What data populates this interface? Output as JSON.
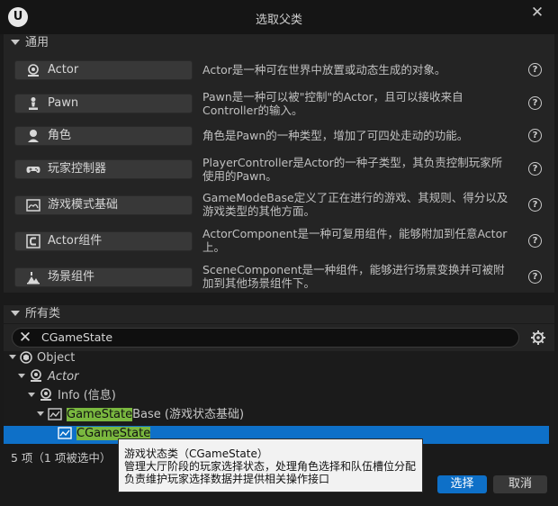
{
  "window": {
    "title": "选取父类",
    "close_glyph": "✕",
    "logo_glyph": "U"
  },
  "common": {
    "header": "通用",
    "items": [
      {
        "label": "Actor",
        "icon": "actor-icon",
        "desc": "Actor是一种可在世界中放置或动态生成的对象。"
      },
      {
        "label": "Pawn",
        "icon": "pawn-icon",
        "desc": "Pawn是一种可以被\"控制\"的Actor，且可以接收来自Controller的输入。"
      },
      {
        "label": "角色",
        "icon": "character-icon",
        "desc": "角色是Pawn的一种类型，增加了可四处走动的功能。"
      },
      {
        "label": "玩家控制器",
        "icon": "gamepad-icon",
        "desc": "PlayerController是Actor的一种子类型，其负责控制玩家所使用的Pawn。"
      },
      {
        "label": "游戏模式基础",
        "icon": "gamemode-icon",
        "desc": "GameModeBase定义了正在进行的游戏、其规则、得分以及游戏类型的其他方面。"
      },
      {
        "label": "Actor组件",
        "icon": "component-icon",
        "desc": "ActorComponent是一种可复用组件，能够附加到任意Actor上。"
      },
      {
        "label": "场景组件",
        "icon": "scene-component-icon",
        "desc": "SceneComponent是一种组件，能够进行场景变换并可被附加到其他场景组件下。"
      }
    ],
    "help_glyph": "?"
  },
  "all_classes": {
    "header": "所有类",
    "search_value": "CGameState",
    "clear_glyph": "✕"
  },
  "tree": {
    "nodes": [
      {
        "label": "Object"
      },
      {
        "label": "Actor"
      },
      {
        "label": "Info (信息)"
      },
      {
        "label_hl": "GameState",
        "label_rest": "Base (游戏状态基础)"
      },
      {
        "label_hl": "CGameState",
        "label_rest": ""
      }
    ]
  },
  "footer": {
    "count": "5 项（1 项被选中）",
    "select": "选择",
    "cancel": "取消"
  },
  "tooltip": {
    "line1": "游戏状态类（CGameState）",
    "line2": "管理大厅阶段的玩家选择状态，处理角色选择和队伍槽位分配",
    "line3": "负责维护玩家选择数据并提供相关操作接口"
  },
  "colors": {
    "accent": "#0e70c8",
    "highlight": "#7ab83f",
    "panel": "#242424",
    "background": "#1a1a1a"
  }
}
